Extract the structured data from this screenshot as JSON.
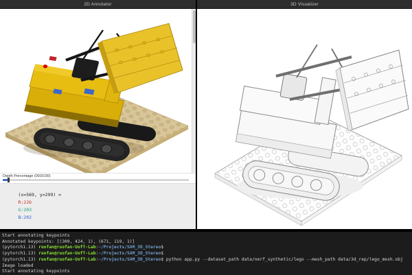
{
  "annotator": {
    "title": "2D Annotator",
    "depth_slider": {
      "label": "Depth Percentage (003/100)",
      "value_percent": 3
    },
    "readout": {
      "coords": "(x=569, y=299) =",
      "r": "R:226",
      "g": "G:203",
      "b": "B:202"
    },
    "readout_colors": {
      "r": "#c03020",
      "g": "#159a7b",
      "b": "#2b5fd9"
    },
    "keypoint_color": "#dd0000"
  },
  "visualizer": {
    "title": "3D Visualizer"
  },
  "terminal": {
    "prompt_colors": {
      "user": "#8ae234",
      "path": "#729fcf",
      "text": "#d6d6d6"
    },
    "lines": [
      {
        "segments": [
          {
            "t": "Start annotating keypoints",
            "c": "plain"
          }
        ]
      },
      {
        "segments": [
          {
            "t": "Annotated keypoints: [(309, 424, 1), (671, 119, 1)]",
            "c": "plain"
          }
        ]
      },
      {
        "segments": [
          {
            "t": "(pytorch1.13) ",
            "c": "plain"
          },
          {
            "t": "ruofan@ruofan-UofT-Lab",
            "c": "green"
          },
          {
            "t": ":",
            "c": "plain"
          },
          {
            "t": "~/Projects/SAM_3D_Stereo",
            "c": "blue"
          },
          {
            "t": "$",
            "c": "plain"
          }
        ]
      },
      {
        "segments": [
          {
            "t": "(pytorch1.13) ",
            "c": "plain"
          },
          {
            "t": "ruofan@ruofan-UofT-Lab",
            "c": "green"
          },
          {
            "t": ":",
            "c": "plain"
          },
          {
            "t": "~/Projects/SAM_3D_Stereo",
            "c": "blue"
          },
          {
            "t": "$",
            "c": "plain"
          }
        ]
      },
      {
        "segments": [
          {
            "t": "(pytorch1.13) ",
            "c": "plain"
          },
          {
            "t": "ruofan@ruofan-UofT-Lab",
            "c": "green"
          },
          {
            "t": ":",
            "c": "plain"
          },
          {
            "t": "~/Projects/SAM_3D_Stereo",
            "c": "blue"
          },
          {
            "t": "$ python app.py --dataset_path data/nerf_synthetic/lego --mesh_path data/3d_rep/lego_mesh.obj",
            "c": "plain"
          }
        ]
      },
      {
        "segments": [
          {
            "t": "Image loaded",
            "c": "plain"
          }
        ]
      },
      {
        "segments": [
          {
            "t": "Start annotating keypoints",
            "c": "plain"
          }
        ]
      }
    ]
  }
}
